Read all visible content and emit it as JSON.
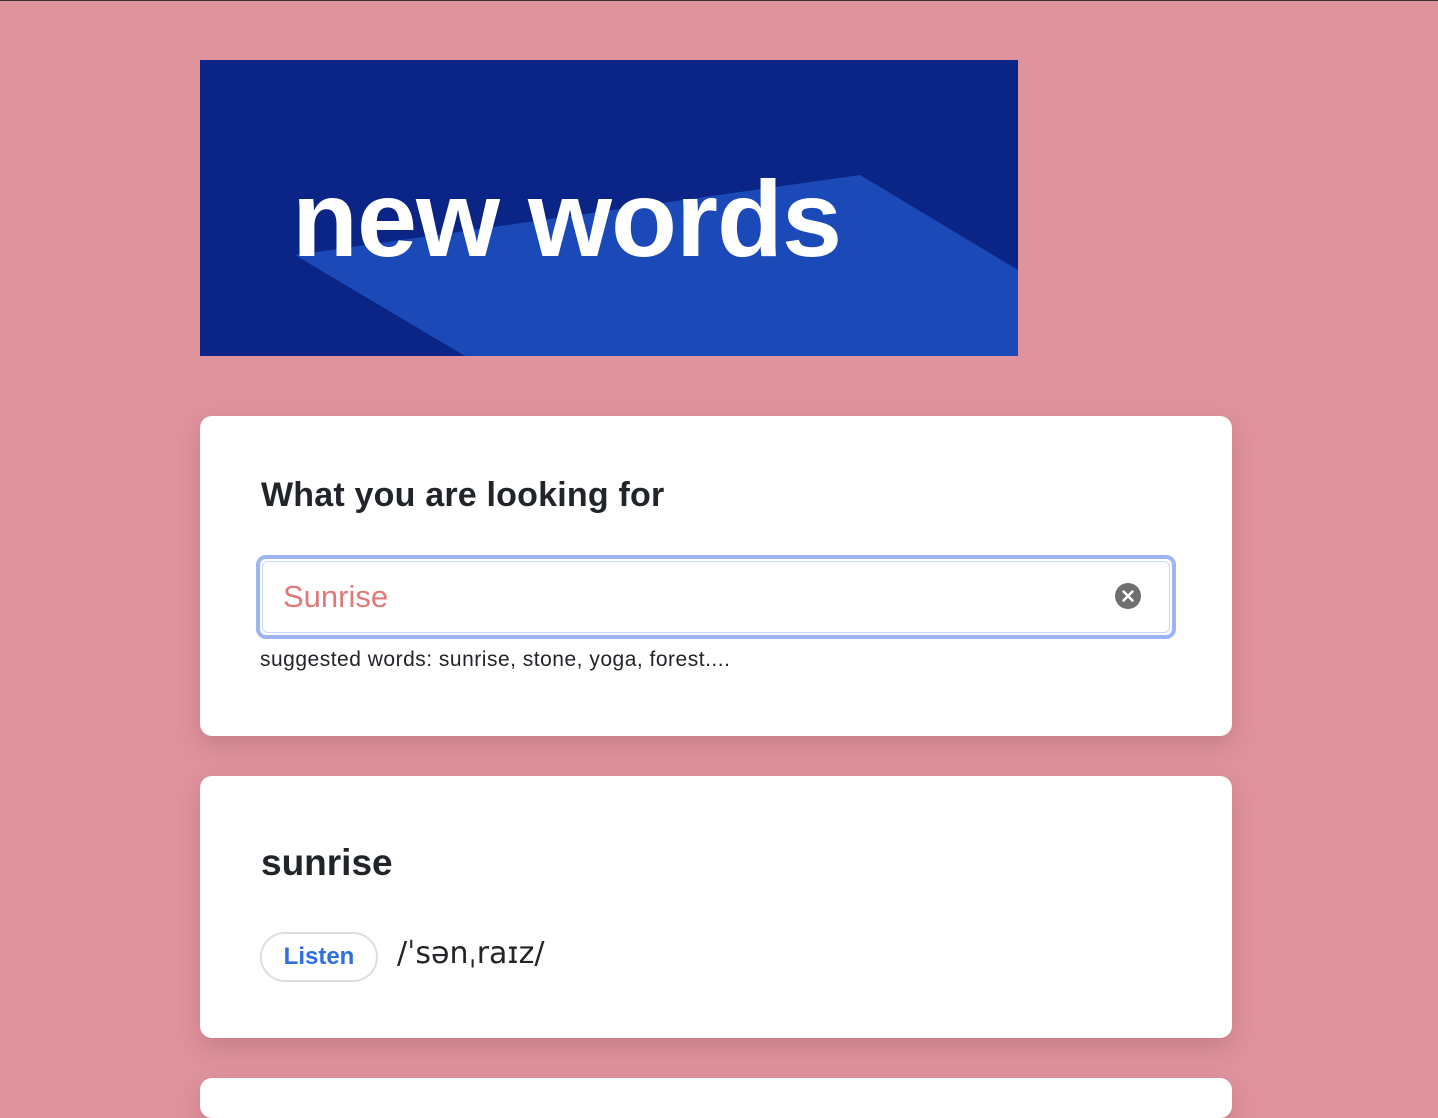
{
  "banner": {
    "text": "new words",
    "colors": {
      "background": "#0a2585",
      "shadow": "#1c49b8",
      "text": "#ffffff"
    }
  },
  "search": {
    "title": "What you are looking for",
    "value": "Sunrise",
    "clear_icon": "close-circle-icon",
    "hint": "suggested words: sunrise, stone, yoga, forest...."
  },
  "result": {
    "word": "sunrise",
    "listen_label": "Listen",
    "phonetic": "/ˈsənˌraɪz/"
  },
  "colors": {
    "page_background": "#df939d",
    "input_text": "#e07a7a",
    "focus_ring": "#9cb5f0",
    "listen_text": "#2f6fe0"
  }
}
